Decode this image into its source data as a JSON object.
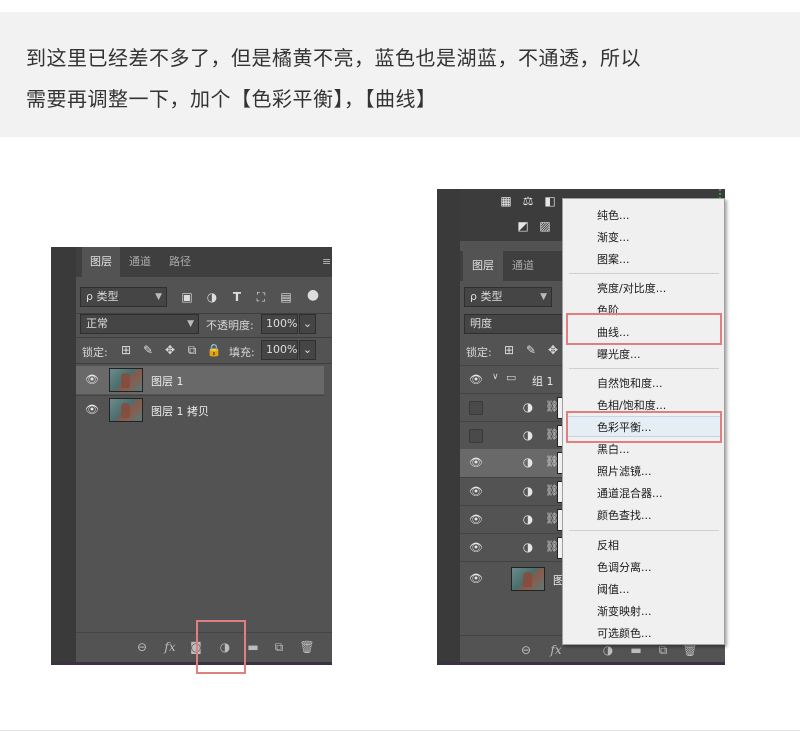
{
  "caption": {
    "line1": "到这里已经差不多了，但是橘黄不亮，蓝色也是湖蓝，不通透，所以",
    "line2": "需要再调整一下，加个【色彩平衡】，【曲线】"
  },
  "left_panel": {
    "tabs": [
      "图层",
      "通道",
      "路径"
    ],
    "filter_label": "ρ 类型",
    "blend_mode": "正常",
    "opacity_label": "不透明度:",
    "opacity_value": "100%",
    "lock_label": "锁定:",
    "fill_label": "填充:",
    "fill_value": "100%",
    "layers": [
      {
        "name": "图层 1",
        "selected": true
      },
      {
        "name": "图层 1 拷贝",
        "selected": false
      }
    ],
    "footer_fx": "fx"
  },
  "right_panel": {
    "tabs": [
      "图层",
      "通道"
    ],
    "filter_label": "ρ 类型",
    "blend_mode": "明度",
    "lock_label": "锁定:",
    "group_name": "组 1",
    "bottom_layer_name": "图",
    "footer_fx": "fx"
  },
  "context_menu": {
    "groups": [
      [
        "纯色...",
        "渐变...",
        "图案..."
      ],
      [
        "亮度/对比度...",
        "色阶",
        "曲线...",
        "曝光度..."
      ],
      [
        "自然饱和度...",
        "色相/饱和度...",
        "色彩平衡...",
        "黑白...",
        "照片滤镜...",
        "通道混合器...",
        "颜色查找..."
      ],
      [
        "反相",
        "色调分离...",
        "阈值...",
        "渐变映射...",
        "可选颜色..."
      ]
    ],
    "highlighted": "色彩平衡..."
  },
  "colors": {
    "panel_bg": "#535353",
    "highlight_box": "#e07f7f",
    "menu_bg": "#f0f0f0"
  }
}
